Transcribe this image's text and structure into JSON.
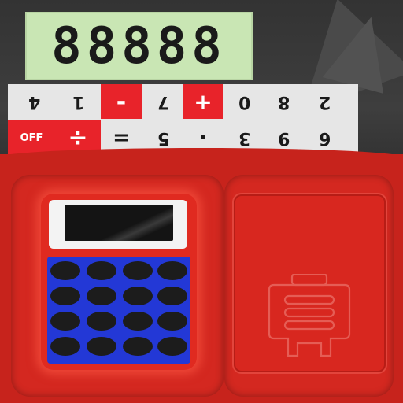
{
  "display": {
    "digits": "88888"
  },
  "keys": {
    "row1": [
      {
        "id": "key-4",
        "label": "4",
        "style": "gray",
        "flipped": true
      },
      {
        "id": "key-1",
        "label": "1",
        "style": "gray",
        "flipped": true
      },
      {
        "id": "key-minus",
        "label": "-",
        "style": "red",
        "flipped": false
      },
      {
        "id": "key-7",
        "label": "7",
        "style": "gray",
        "flipped": true
      },
      {
        "id": "key-plus",
        "label": "+",
        "style": "red",
        "flipped": false
      },
      {
        "id": "key-0",
        "label": "0",
        "style": "gray",
        "flipped": true
      },
      {
        "id": "key-8",
        "label": "8",
        "style": "gray",
        "flipped": true
      },
      {
        "id": "key-2",
        "label": "2",
        "style": "gray",
        "flipped": true
      }
    ],
    "row2": [
      {
        "id": "key-off",
        "label": "OFF",
        "style": "red",
        "flipped": false
      },
      {
        "id": "key-divide",
        "label": "÷",
        "style": "red",
        "flipped": false
      },
      {
        "id": "key-equals",
        "label": "=",
        "style": "gray",
        "flipped": false
      },
      {
        "id": "key-5",
        "label": "5",
        "style": "gray",
        "flipped": true
      },
      {
        "id": "key-decimal",
        "label": "·",
        "style": "gray",
        "flipped": false
      },
      {
        "id": "key-3",
        "label": "3",
        "style": "gray",
        "flipped": true
      },
      {
        "id": "key-9",
        "label": "9",
        "style": "gray",
        "flipped": true
      },
      {
        "id": "key-6",
        "label": "6",
        "style": "gray",
        "flipped": true
      }
    ]
  },
  "colors": {
    "lcd": "#c9e6b4",
    "accent_red": "#e8232a",
    "panel_red": "#c7231c",
    "mini_keypad_blue": "#2338d6",
    "key_gray": "#e6e6e6"
  },
  "icons": {
    "calculator": "calculator-icon",
    "case": "case-icon"
  }
}
